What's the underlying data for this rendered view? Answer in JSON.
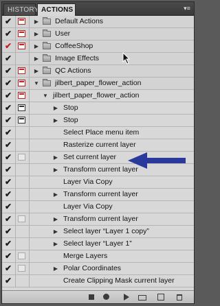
{
  "panel": {
    "tabs": [
      {
        "label": "HISTORY"
      },
      {
        "label": "ACTIONS"
      }
    ],
    "menu_glyph": "▾≡"
  },
  "colors": {
    "check": "#1a1a1a",
    "check_alert": "#c22020",
    "annotation_arrow": "#2a3a9c"
  },
  "rows": [
    {
      "label": "Default Actions",
      "kind": "set",
      "expand": "collapsed",
      "check": "black",
      "dialog": "red"
    },
    {
      "label": "User",
      "kind": "set",
      "expand": "collapsed",
      "check": "black",
      "dialog": "red"
    },
    {
      "label": "CoffeeShop",
      "kind": "set",
      "expand": "collapsed",
      "check": "red",
      "dialog": "red"
    },
    {
      "label": "Image Effects",
      "kind": "set",
      "expand": "collapsed",
      "check": "black",
      "dialog": "none"
    },
    {
      "label": "QC Actions",
      "kind": "set",
      "expand": "collapsed",
      "check": "black",
      "dialog": "red"
    },
    {
      "label": "jilbert_paper_flower_action",
      "kind": "set",
      "expand": "expanded",
      "check": "black",
      "dialog": "red"
    },
    {
      "label": "jilbert_paper_flower_action",
      "kind": "action",
      "expand": "expanded",
      "check": "black",
      "dialog": "red"
    },
    {
      "label": "Stop",
      "kind": "step",
      "expand": "collapsed",
      "check": "black",
      "dialog": "dark"
    },
    {
      "label": "Stop",
      "kind": "step",
      "expand": "collapsed",
      "check": "black",
      "dialog": "dark"
    },
    {
      "label": "Select Place menu item",
      "kind": "step",
      "expand": "none",
      "check": "black",
      "dialog": "none"
    },
    {
      "label": "Rasterize current layer",
      "kind": "step",
      "expand": "none",
      "check": "black",
      "dialog": "none"
    },
    {
      "label": "Set current layer",
      "kind": "step",
      "expand": "collapsed",
      "check": "black",
      "dialog": "faint"
    },
    {
      "label": "Transform current layer",
      "kind": "step",
      "expand": "collapsed",
      "check": "black",
      "dialog": "none"
    },
    {
      "label": "Layer Via Copy",
      "kind": "step",
      "expand": "none",
      "check": "black",
      "dialog": "none"
    },
    {
      "label": "Transform current layer",
      "kind": "step",
      "expand": "collapsed",
      "check": "black",
      "dialog": "none"
    },
    {
      "label": "Layer Via Copy",
      "kind": "step",
      "expand": "none",
      "check": "black",
      "dialog": "none"
    },
    {
      "label": "Transform current layer",
      "kind": "step",
      "expand": "collapsed",
      "check": "black",
      "dialog": "faint"
    },
    {
      "label": "Select layer “Layer 1 copy”",
      "kind": "step",
      "expand": "collapsed",
      "check": "black",
      "dialog": "none"
    },
    {
      "label": "Select layer “Layer 1”",
      "kind": "step",
      "expand": "collapsed",
      "check": "black",
      "dialog": "none"
    },
    {
      "label": "Merge Layers",
      "kind": "step",
      "expand": "none",
      "check": "black",
      "dialog": "faint"
    },
    {
      "label": "Polar Coordinates",
      "kind": "step",
      "expand": "collapsed",
      "check": "black",
      "dialog": "faint"
    },
    {
      "label": "Create Clipping Mask current layer",
      "kind": "step",
      "expand": "none",
      "check": "black",
      "dialog": "none"
    }
  ],
  "bottom_buttons": [
    {
      "name": "stop-playing-button"
    },
    {
      "name": "begin-recording-button"
    },
    {
      "name": "play-selection-button"
    },
    {
      "name": "create-new-set-button"
    },
    {
      "name": "create-new-action-button"
    },
    {
      "name": "delete-button"
    }
  ]
}
